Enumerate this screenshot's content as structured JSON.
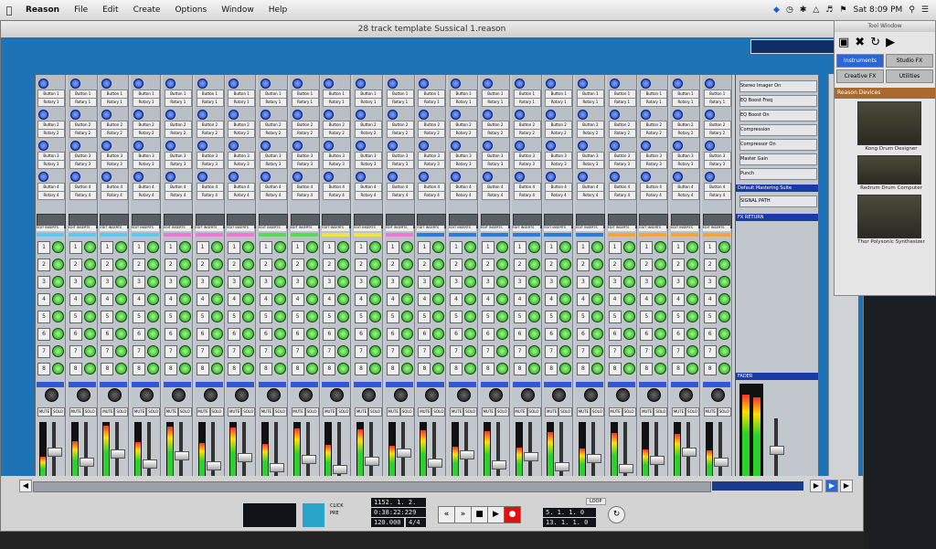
{
  "menubar": {
    "app": "Reason",
    "items": [
      "File",
      "Edit",
      "Create",
      "Options",
      "Window",
      "Help"
    ],
    "clock": "Sat 8:09 PM"
  },
  "window": {
    "title": "28 track template Sussical 1.reason"
  },
  "mixer": {
    "remote_rows": [
      [
        "Button 1",
        "Rotary 1"
      ],
      [
        "Button 2",
        "Rotary 2"
      ],
      [
        "Button 3",
        "Rotary 3"
      ],
      [
        "Button 4",
        "Rotary 4"
      ]
    ],
    "edit_inserts": "EDIT INSERTS",
    "fx_send_numbers": [
      "1",
      "2",
      "3",
      "4",
      "5",
      "6",
      "7",
      "8"
    ],
    "mute": "MUTE",
    "solo": "SOLO",
    "channels": [
      {
        "name": "Cat in the Hat",
        "color": "#5ec8f0"
      },
      {
        "name": "JoJo",
        "color": "#5ec8f0"
      },
      {
        "name": "Horton the Elephant",
        "color": "#5ec8f0"
      },
      {
        "name": "Gertrude",
        "color": "#5ec8f0"
      },
      {
        "name": "Bad Girl 1",
        "color": "#e87ad8"
      },
      {
        "name": "Bad Girl 2",
        "color": "#e87ad8"
      },
      {
        "name": "Bad Girl 3",
        "color": "#e87ad8"
      },
      {
        "name": "Sour Kangaroo",
        "color": "#5cd65c"
      },
      {
        "name": "Young Kangaroo",
        "color": "#5cd65c"
      },
      {
        "name": "Mr Mayor",
        "color": "#f2e43c"
      },
      {
        "name": "Mrs. Mayor",
        "color": "#f2e43c"
      },
      {
        "name": "Mayzi",
        "color": "#e87ad8"
      },
      {
        "name": "Wickersha m Bro 1",
        "color": "#2f7bd8"
      },
      {
        "name": "Wickersha m Bro 2",
        "color": "#2f7bd8"
      },
      {
        "name": "Wickersha m Bro 3",
        "color": "#2f7bd8"
      },
      {
        "name": "Wickersha m Bro 4",
        "color": "#2f7bd8"
      },
      {
        "name": "The Judge",
        "color": "#2f7bd8"
      },
      {
        "name": "DESE TALK",
        "color": "#2f7bd8"
      },
      {
        "name": "Stage Mic Left",
        "color": "#f2a53c"
      },
      {
        "name": "Stage Mic Right",
        "color": "#f2a53c"
      },
      {
        "name": "MP3 Audio Track Left",
        "color": "#f2a53c"
      },
      {
        "name": "MP3 Audio Track",
        "color": "#f2a53c"
      }
    ],
    "master": {
      "remote_labels": [
        "Stereo Imager On",
        "EQ Boost Freq",
        "EQ Boost On",
        "Compression",
        "Compressor On",
        "Master Gain",
        "Punch"
      ],
      "preset": "Default Mastering Suite",
      "fx_return": "FX RETURN",
      "signal_path": "SIGNAL PATH",
      "fader_label": "FADER"
    }
  },
  "tool_window": {
    "title": "Tool Window",
    "tabs": [
      "Instruments",
      "Studio FX",
      "Creative FX",
      "Utilities"
    ],
    "section": "Reason Devices",
    "devices": [
      "Kong Drum Designer",
      "Redrum Drum Computer",
      "Thor Polysonic Synthesizer"
    ]
  },
  "transport": {
    "position": "1152. 1. 2. 200",
    "time": "0:38:22:229",
    "tempo": "120.000",
    "signature": "4/4",
    "loop_start": "5. 1. 1. 0",
    "loop_end": "13. 1. 1. 0",
    "loop_label": "LOOP",
    "click_label": "CLICK",
    "pre_label": "PRE"
  }
}
